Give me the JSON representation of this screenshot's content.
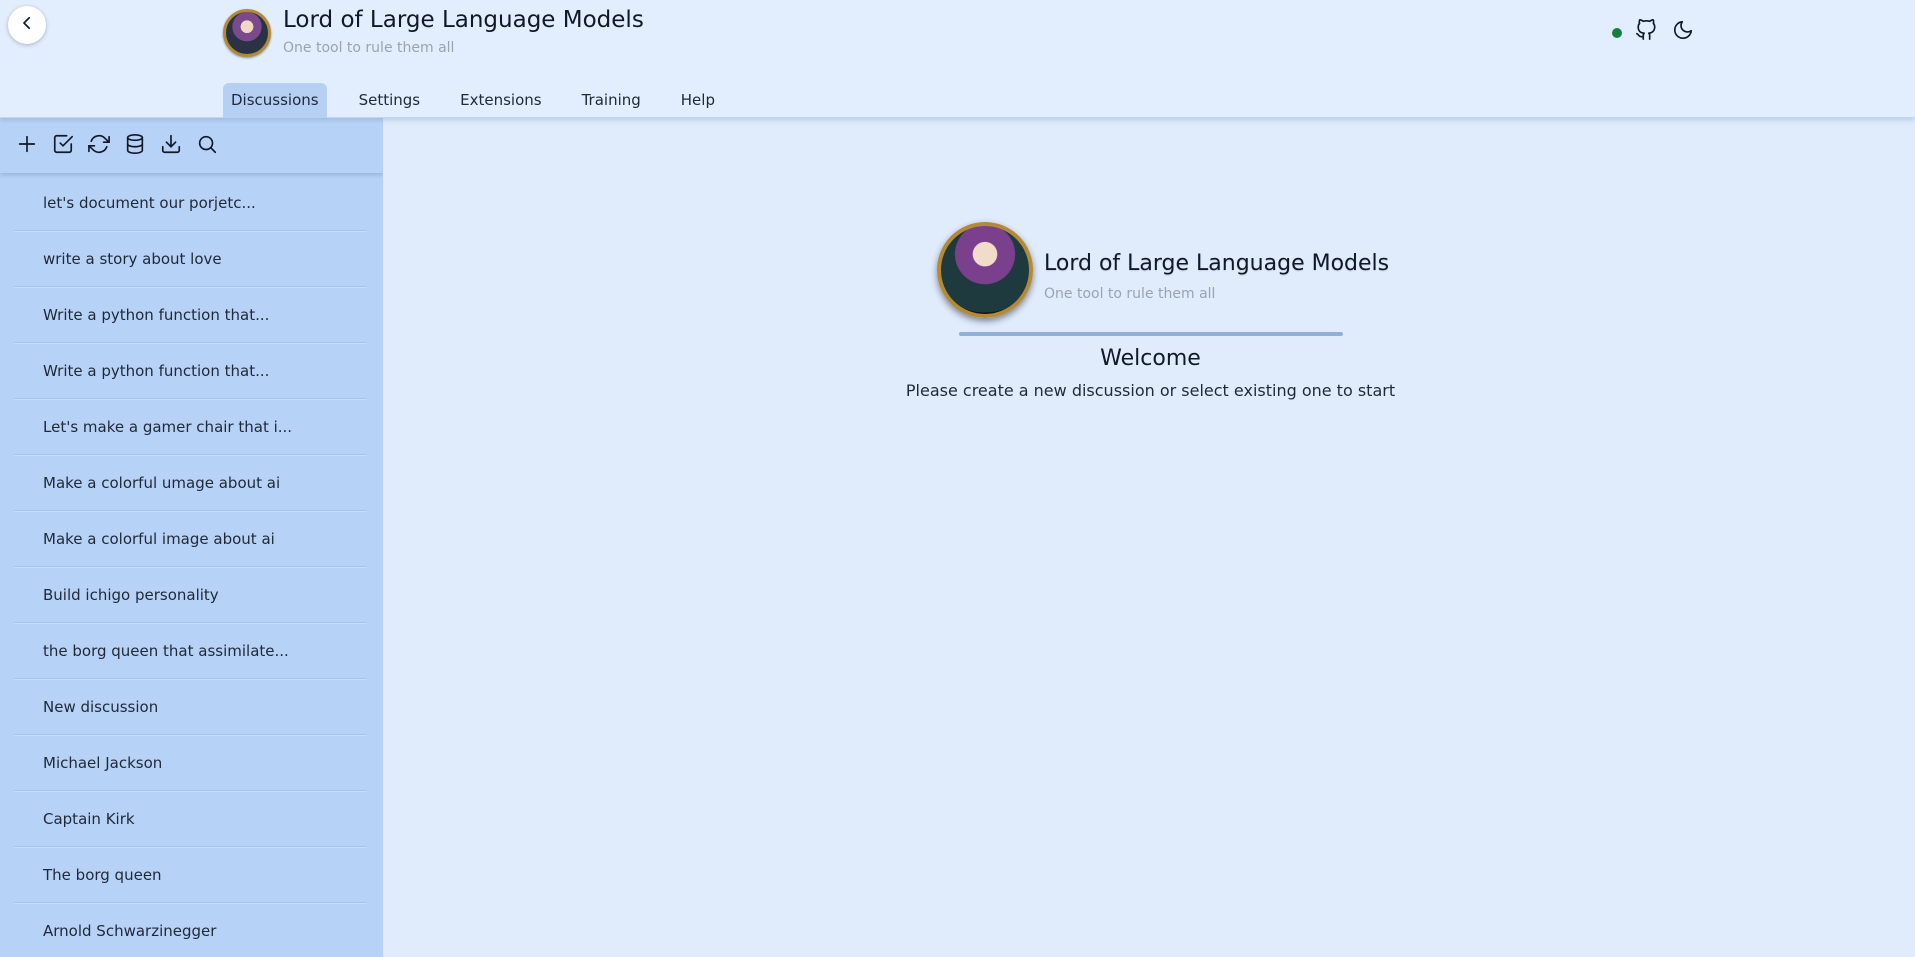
{
  "header": {
    "title": "Lord of Large Language Models",
    "subtitle": "One tool to rule them all",
    "connection_status_color": "#15803d",
    "icons": [
      "chevron-left-icon",
      "github-icon",
      "moon-icon"
    ]
  },
  "tabs": [
    {
      "label": "Discussions",
      "active": true
    },
    {
      "label": "Settings",
      "active": false
    },
    {
      "label": "Extensions",
      "active": false
    },
    {
      "label": "Training",
      "active": false
    },
    {
      "label": "Help",
      "active": false
    }
  ],
  "sidebar": {
    "toolbar": [
      "plus-icon",
      "check-square-icon",
      "refresh-icon",
      "database-icon",
      "download-icon",
      "search-icon"
    ],
    "discussions": [
      "let's document our porjetc...",
      "write a story about love",
      "Write a python function that...",
      "Write a python function that...",
      "Let's make a gamer chair that i...",
      "Make a colorful umage about ai",
      "Make a colorful image about ai",
      "Build ichigo personality",
      "the borg queen that assimilate...",
      "New discussion",
      "Michael Jackson",
      "Captain Kirk",
      "The borg queen",
      "Arnold Schwarzinegger"
    ]
  },
  "welcome": {
    "title": "Lord of Large Language Models",
    "subtitle": "One tool to rule them all",
    "heading": "Welcome",
    "message": "Please create a new discussion or select existing one to start"
  },
  "colors": {
    "header_bg": "#e2edfd",
    "sidebar_bg": "#b7d2f7",
    "main_bg": "#e0ebfc",
    "active_tab_bg": "#b6d0f4",
    "divider": "#8fb1d9"
  }
}
